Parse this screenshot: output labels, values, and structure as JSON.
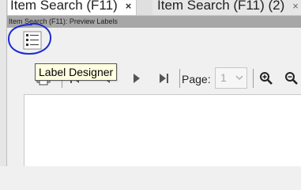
{
  "tabs": [
    {
      "label": "Item Search (F11)",
      "close": "×",
      "active": true
    },
    {
      "label": "Item Search (F11) (2)",
      "close": "×",
      "active": false
    }
  ],
  "window_title": "Item Search (F11): Preview Labels",
  "tooltip": "Label Designer",
  "toolbar": {
    "page_label": "Page:",
    "page_value": "1"
  },
  "icons": {
    "designer": "label-designer-icon",
    "print": "print-icon",
    "first": "first-page-icon",
    "previous": "previous-page-icon",
    "next": "next-page-icon",
    "last": "last-page-icon",
    "page_select": "chevron-down-icon",
    "zoom_in": "zoom-in-icon",
    "zoom_out": "zoom-out-icon"
  },
  "colors": {
    "annotation": "#1d2bd6",
    "tooltip_bg": "#ffffe1",
    "title_bar": "#a7a7a7"
  }
}
